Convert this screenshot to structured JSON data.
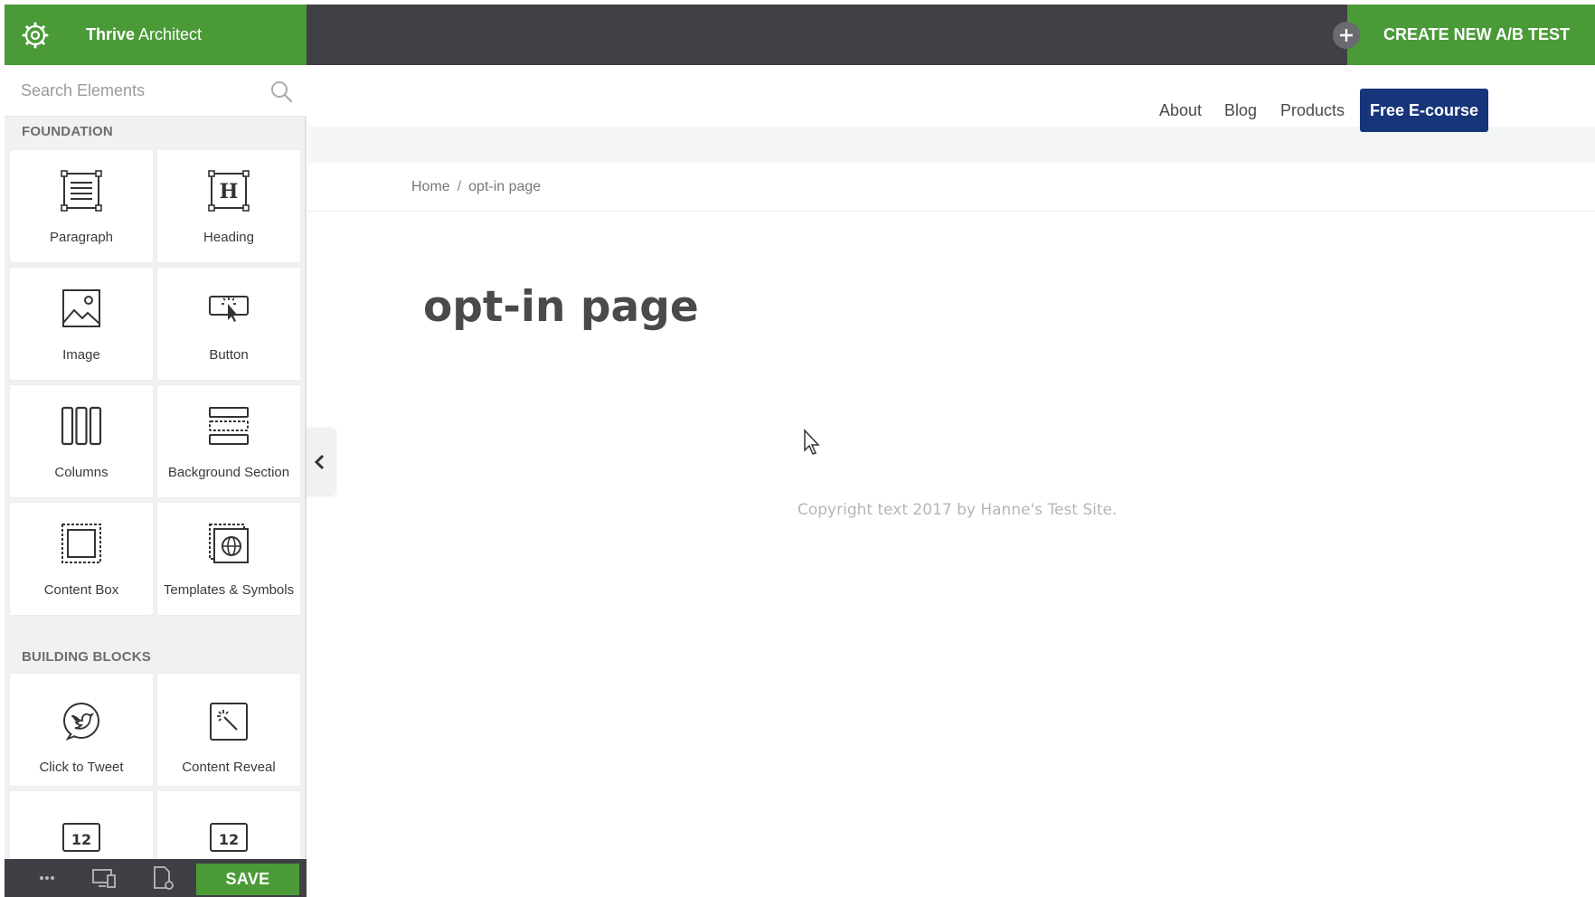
{
  "editor": {
    "brand_bold": "Thrive",
    "brand_rest": " Architect",
    "search_placeholder": "Search Elements",
    "ab_test_label": "CREATE NEW A/B TEST",
    "save_label": "SAVE"
  },
  "sidebar": {
    "foundation_title": "FOUNDATION",
    "building_blocks_title": "BUILDING BLOCKS",
    "foundation": [
      {
        "label": "Paragraph",
        "icon": "paragraph-icon"
      },
      {
        "label": "Heading",
        "icon": "heading-icon"
      },
      {
        "label": "Image",
        "icon": "image-icon"
      },
      {
        "label": "Button",
        "icon": "button-icon"
      },
      {
        "label": "Columns",
        "icon": "columns-icon"
      },
      {
        "label": "Background Section",
        "icon": "background-section-icon"
      },
      {
        "label": "Content Box",
        "icon": "content-box-icon"
      },
      {
        "label": "Templates & Symbols",
        "icon": "templates-symbols-icon"
      }
    ],
    "building_blocks": [
      {
        "label": "Click to Tweet",
        "icon": "twitter-icon"
      },
      {
        "label": "Content Reveal",
        "icon": "content-reveal-icon"
      }
    ],
    "footer_icons": [
      "more-icon",
      "responsive-view-icon",
      "page-settings-icon"
    ]
  },
  "site": {
    "nav": [
      "About",
      "Blog",
      "Products"
    ],
    "cta_label": "Free E-course",
    "breadcrumb": [
      "Home",
      "opt-in page"
    ],
    "page_title": "opt-in page",
    "copyright": "Copyright text 2017 by Hanne's Test Site."
  },
  "colors": {
    "brand_green": "#4b9a38",
    "toolbar_dark": "#404045",
    "cta_blue": "#16357a"
  }
}
